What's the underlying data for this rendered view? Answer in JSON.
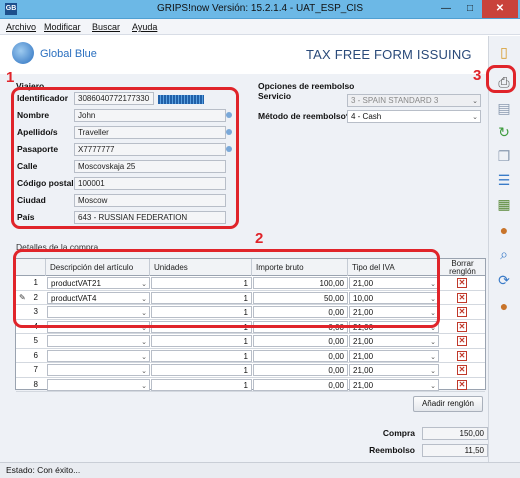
{
  "window": {
    "title": "GRIPS!now Versión: 15.2.1.4 - UAT_ESP_CIS",
    "app_icon_label": "GB",
    "minimize": "—",
    "maximize": "□",
    "close": "✕"
  },
  "menu": [
    "Archivo",
    "Modificar",
    "Buscar",
    "Ayuda"
  ],
  "header": {
    "logo_text": "Global Blue",
    "title": "TAX FREE FORM ISSUING"
  },
  "viajero": {
    "section_title": "Viajero",
    "fields": [
      {
        "label": "Identificador",
        "value": "3086040772177330"
      },
      {
        "label": "Nombre",
        "value": "John"
      },
      {
        "label": "Apellido/s",
        "value": "Traveller"
      },
      {
        "label": "Pasaporte",
        "value": "X7777777"
      },
      {
        "label": "Calle",
        "value": "Moscovskaja 25"
      },
      {
        "label": "Código postal",
        "value": "100001"
      },
      {
        "label": "Ciudad",
        "value": "Moscow"
      },
      {
        "label": "País",
        "value": "643 - RUSSIAN FEDERATION"
      }
    ]
  },
  "reembolso": {
    "section_title": "Opciones de reembolso",
    "servicio_label": "Servicio",
    "servicio_value": "3 - SPAIN STANDARD 3",
    "metodo_label": "Método de reembolso*",
    "metodo_value": "4 - Cash"
  },
  "compra": {
    "section_title": "Detalles de la compra",
    "columns": [
      "Descripción del artículo",
      "Unidades",
      "Importe bruto",
      "Tipo del IVA",
      "Borrar renglón"
    ],
    "rows": [
      {
        "n": "1",
        "desc": "productVAT21",
        "units": "1",
        "amount": "100,00",
        "vat": "21,00"
      },
      {
        "n": "2",
        "desc": "productVAT4",
        "units": "1",
        "amount": "50,00",
        "vat": "10,00"
      },
      {
        "n": "3",
        "desc": "",
        "units": "1",
        "amount": "0,00",
        "vat": "21,00"
      },
      {
        "n": "4",
        "desc": "",
        "units": "1",
        "amount": "0,00",
        "vat": "21,00"
      },
      {
        "n": "5",
        "desc": "",
        "units": "1",
        "amount": "0,00",
        "vat": "21,00"
      },
      {
        "n": "6",
        "desc": "",
        "units": "1",
        "amount": "0,00",
        "vat": "21,00"
      },
      {
        "n": "7",
        "desc": "",
        "units": "1",
        "amount": "0,00",
        "vat": "21,00"
      },
      {
        "n": "8",
        "desc": "",
        "units": "1",
        "amount": "0,00",
        "vat": "21,00"
      }
    ],
    "add_row_label": "Añadir renglón"
  },
  "totals": {
    "compra_label": "Compra",
    "compra_value": "150,00",
    "reembolso_label": "Reembolso",
    "reembolso_value": "11,50"
  },
  "status": "Estado:  Con éxito...",
  "annotations": [
    "1",
    "2",
    "3"
  ],
  "glyphs": {
    "caret": "⌄",
    "delete": "✕",
    "pencil": "✎"
  },
  "toolbar_icons": [
    "new-document-icon",
    "print-icon",
    "edit-document-icon",
    "refresh-document-icon",
    "copy-document-icon",
    "list-document-icon",
    "cash-icon",
    "user-icon",
    "search-document-icon",
    "sync-icon",
    "user-settings-icon"
  ],
  "colors": {
    "titlebar": "#6cb8e6",
    "accent": "#2a6fbf",
    "annotation": "#e0242a",
    "close": "#c9423a"
  }
}
